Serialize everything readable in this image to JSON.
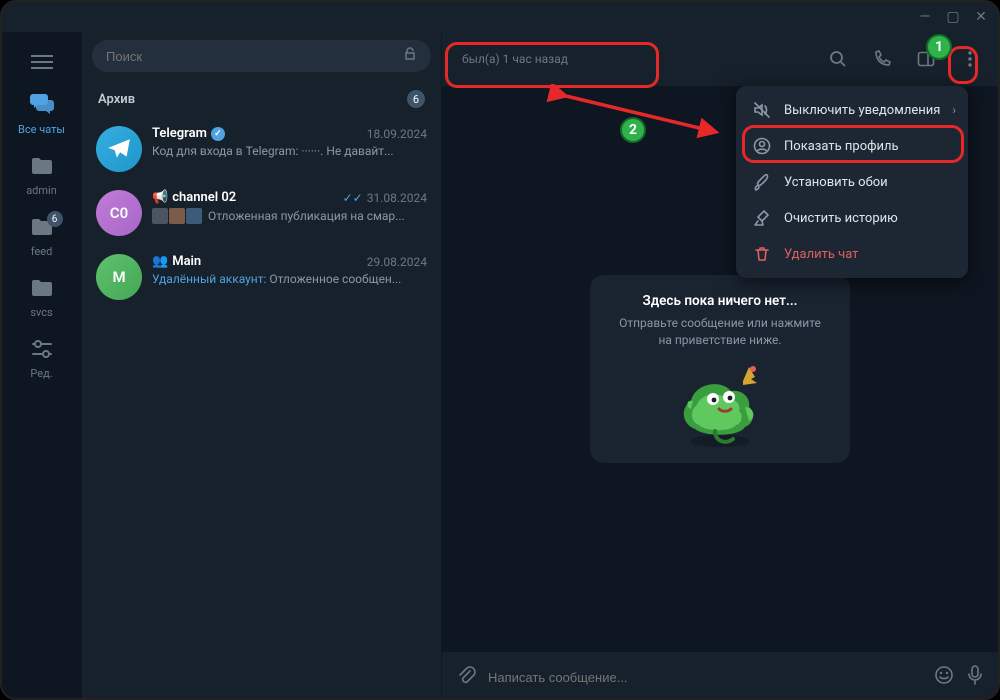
{
  "window": {
    "minimize": "—",
    "maximize": "▢",
    "close": "✕"
  },
  "nav": {
    "all_chats": "Все чаты",
    "folders": [
      {
        "label": "admin"
      },
      {
        "label": "feed",
        "badge": "6"
      },
      {
        "label": "svcs"
      },
      {
        "label": "Ред."
      }
    ]
  },
  "search": {
    "placeholder": "Поиск"
  },
  "archive": {
    "label": "Архив",
    "count": "6"
  },
  "chats": [
    {
      "name": "Telegram",
      "verified": true,
      "date": "18.09.2024",
      "preview_prefix": "",
      "preview": "Код для входа в Telegram: ······. Не давайт..."
    },
    {
      "name": "channel 02",
      "checks": true,
      "date": "31.08.2024",
      "preview_prefix": "",
      "preview": "Отложенная публикация на смар..."
    },
    {
      "name": "Main",
      "date": "29.08.2024",
      "preview_prefix": "Удалённый аккаунт:",
      "preview": " Отложенное сообщен..."
    }
  ],
  "chat_header": {
    "status": "был(а) 1 час назад"
  },
  "empty": {
    "title": "Здесь пока ничего нет...",
    "subtitle": "Отправьте сообщение или нажмите на приветствие ниже."
  },
  "compose": {
    "placeholder": "Написать сообщение..."
  },
  "menu": {
    "mute": "Выключить уведомления",
    "profile": "Показать профиль",
    "wallpaper": "Установить обои",
    "clear": "Очистить историю",
    "delete": "Удалить чат"
  },
  "annotations": {
    "one": "1",
    "two": "2"
  }
}
